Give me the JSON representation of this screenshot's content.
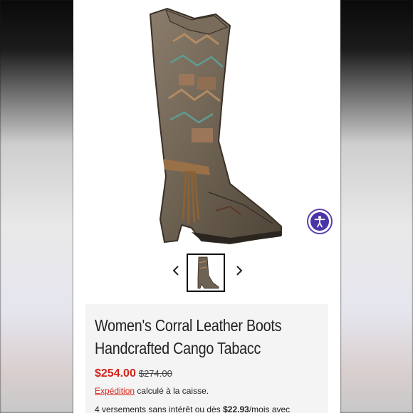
{
  "product": {
    "title_line1": "Women's Corral Leather Boots",
    "title_line2": "Handcrafted Cango Tabacc",
    "price_sale": "$254.00",
    "price_original": "$274.00",
    "shipping_link": "Expédition",
    "shipping_text": "calculé à la caisse.",
    "installments_prefix": "4 versements sans intérêt ou dès",
    "installments_amount": "$22.93",
    "installments_suffix": "/mois avec"
  },
  "icons": {
    "prev": "chevron-left-icon",
    "next": "chevron-right-icon",
    "accessibility": "accessibility-person-icon"
  },
  "colors": {
    "sale": "#d4241b",
    "accessibility": "#4b34a8",
    "panel": "#f4f4f4"
  }
}
